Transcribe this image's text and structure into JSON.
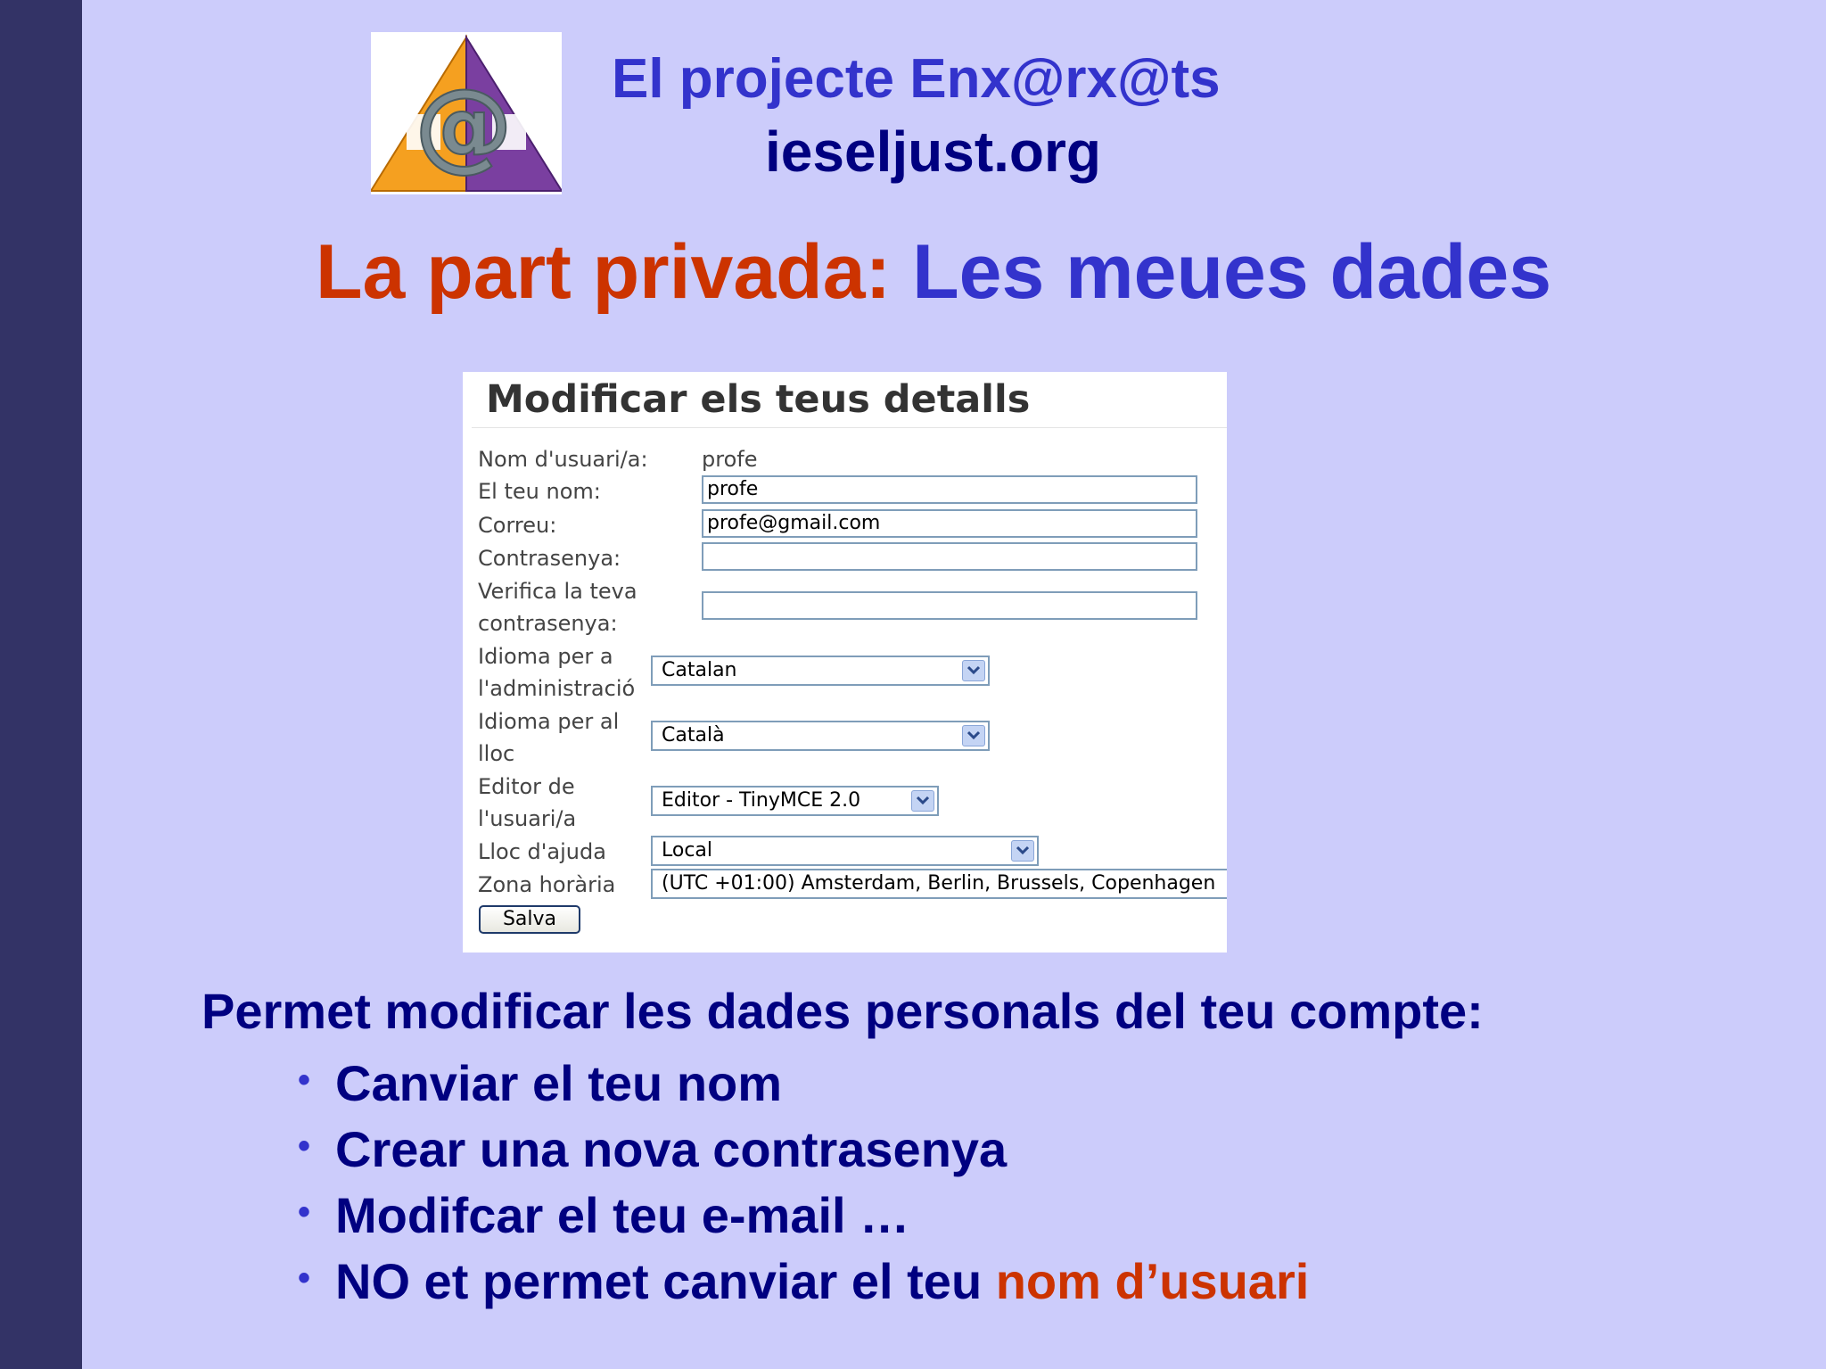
{
  "header": {
    "title": "El projecte Enx@rx@ts",
    "site": "ieseljust.org"
  },
  "slide_title": {
    "part1": "La part privada:",
    "part2": "Les meues dades"
  },
  "form": {
    "title": "Modificar els teus detalls",
    "username_label": "Nom d'usuari/a:",
    "username_value": "profe",
    "name_label": "El teu nom:",
    "name_value": "profe",
    "email_label": "Correu:",
    "email_value": "profe@gmail.com",
    "password_label": "Contrasenya:",
    "password_value": "",
    "verify_label_1": "Verifica la teva",
    "verify_label_2": "contrasenya:",
    "verify_value": "",
    "admin_lang_label_1": "Idioma per a",
    "admin_lang_label_2": "l'administració",
    "admin_lang_value": "Catalan",
    "site_lang_label_1": "Idioma per al",
    "site_lang_label_2": "lloc",
    "site_lang_value": "Català",
    "editor_label_1": "Editor de",
    "editor_label_2": "l'usuari/a",
    "editor_value": "Editor - TinyMCE 2.0",
    "help_label": "Lloc d'ajuda",
    "help_value": "Local",
    "timezone_label": "Zona horària",
    "timezone_value": "(UTC +01:00) Amsterdam, Berlin, Brussels, Copenhagen",
    "save_label": "Salva"
  },
  "description": "Permet modificar les dades personals del teu compte:",
  "bullets": {
    "b1": "Canviar el teu nom",
    "b2": "Crear una nova contrasenya",
    "b3": "Modifcar el teu e-mail …",
    "b4_part1": "NO et permet canviar el teu ",
    "b4_part2": "nom d’usuari"
  },
  "colors": {
    "background": "#ccccfb",
    "sidebar": "#333366",
    "accent_red": "#cc3300",
    "accent_blue": "#3333cc",
    "text_navy": "#000080"
  },
  "icons": [
    "logo-icon",
    "chevron-down-icon"
  ]
}
